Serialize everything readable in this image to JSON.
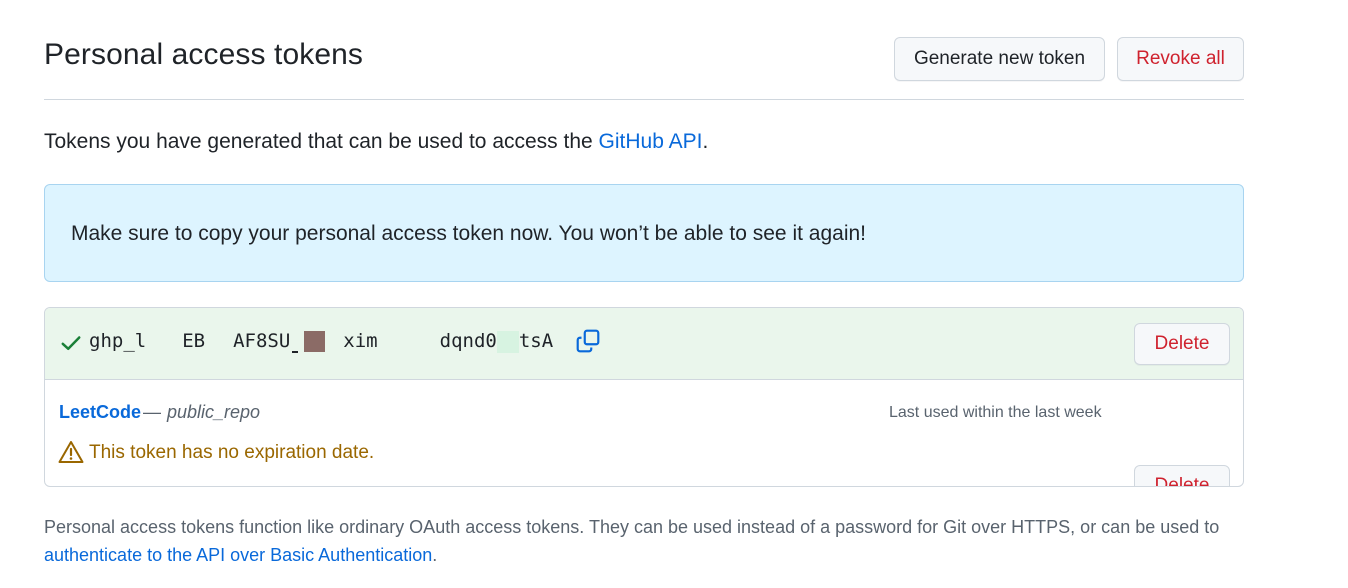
{
  "header": {
    "title": "Personal access tokens",
    "generate_label": "Generate new token",
    "revoke_label": "Revoke all"
  },
  "intro": {
    "text": "Tokens you have generated that can be used to access the ",
    "link": "GitHub API",
    "suffix": "."
  },
  "flash": {
    "message": "Make sure to copy your personal access token now. You won’t be able to see it again!"
  },
  "new_token": {
    "parts": [
      "ghp_l",
      "EB",
      "AF8SU",
      "xim",
      "dqnd0",
      "tsA"
    ],
    "delete_label": "Delete"
  },
  "tokens": [
    {
      "name": "LeetCode",
      "separator": "—",
      "scope": "public_repo",
      "last_used": "Last used within the last week",
      "warning": "This token has no expiration date.",
      "delete_label": "Delete"
    }
  ],
  "footer": {
    "text": "Personal access tokens function like ordinary OAuth access tokens. They can be used instead of a password for Git over HTTPS, or can be used to ",
    "link": "authenticate to the API over Basic Authentication",
    "suffix": "."
  },
  "colors": {
    "accent": "#0969da",
    "danger": "#cf222e",
    "success": "#1a7f37",
    "attention": "#9a6700",
    "flash_bg": "#ddf4ff",
    "new_token_bg": "#eaf6ec",
    "redaction_brown": "#8b6b66"
  },
  "icons": {
    "check": "check-icon",
    "copy": "copy-icon",
    "warning": "alert-icon"
  }
}
